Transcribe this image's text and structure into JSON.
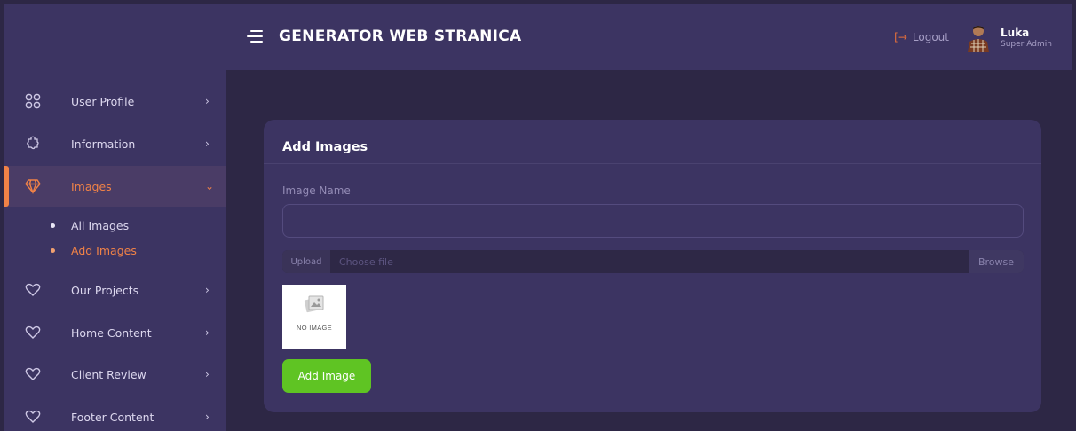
{
  "header": {
    "title": "GENERATOR WEB STRANICA",
    "logout_label": "Logout",
    "user_name": "Luka",
    "user_role": "Super Admin"
  },
  "sidebar": {
    "items": [
      {
        "label": "User Profile",
        "icon": "grid-icon"
      },
      {
        "label": "Information",
        "icon": "puzzle-icon"
      },
      {
        "label": "Images",
        "icon": "diamond-icon",
        "active": true,
        "expanded": true
      },
      {
        "label": "Our Projects",
        "icon": "heart-icon"
      },
      {
        "label": "Home Content",
        "icon": "heart-icon"
      },
      {
        "label": "Client Review",
        "icon": "heart-icon"
      },
      {
        "label": "Footer Content",
        "icon": "heart-icon"
      }
    ],
    "subitems": [
      {
        "label": "All Images"
      },
      {
        "label": "Add Images",
        "active": true
      }
    ]
  },
  "form": {
    "title": "Add Images",
    "name_label": "Image Name",
    "name_value": "",
    "upload_label": "Upload",
    "file_placeholder": "Choose file",
    "browse_label": "Browse",
    "preview_text": "NO IMAGE",
    "submit_label": "Add Image"
  },
  "colors": {
    "accent": "#f08247",
    "panel": "#3c3462",
    "background": "#2d2745",
    "submit": "#5fc423"
  }
}
